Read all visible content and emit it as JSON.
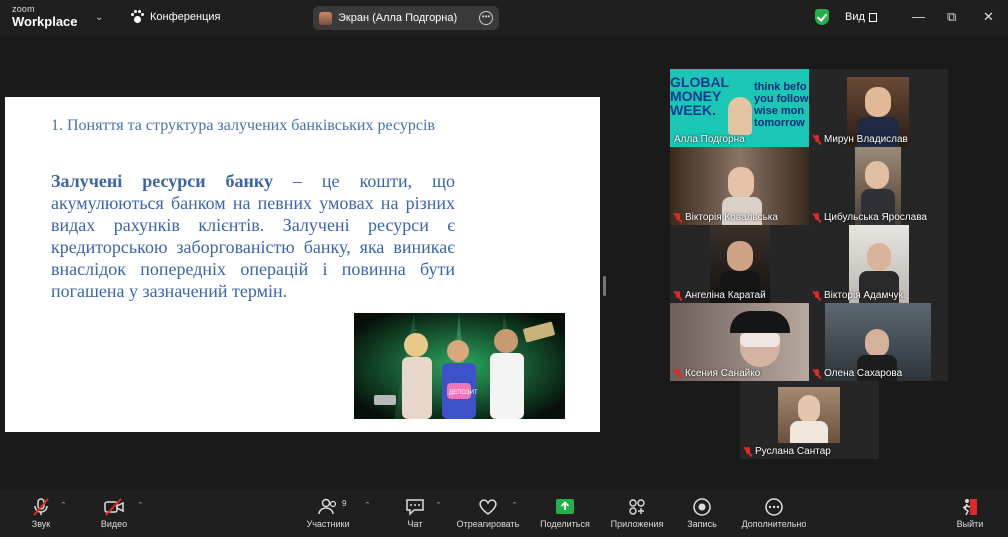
{
  "app": {
    "brand_top": "zoom",
    "brand_bottom": "Workplace"
  },
  "titlebar": {
    "meeting_label": "Конференция",
    "share_pill": "Экран (Алла Подгорна)",
    "view_label": "Вид",
    "shield_color": "#23b14d"
  },
  "slide": {
    "heading": "1. Поняття та структура залучених банківських ресурсів",
    "term": "Залучені ресурси банку",
    "body": " – це кошти, що акумулюються банком на певних умовах на різних видах рахунків клієнтів. Залучені ресурси є кредиторською заборгованістю банку, яка виникає внаслідок попередніх операцій і повинна бути погашена у зазначений термін.",
    "text_color": "#3d63ad",
    "photo_caption": "ДЕПОЗИТ"
  },
  "participants": [
    {
      "name": "Алла Подгорна",
      "muted": false,
      "active": true,
      "banner": [
        "think befo",
        "you follow",
        "wise mon",
        "tomorrow"
      ],
      "banner_left": [
        "GLOBAL",
        "MONEY",
        "WEEK."
      ]
    },
    {
      "name": "Мирун Владислав",
      "muted": true
    },
    {
      "name": "Вікторія Ковальська",
      "muted": true
    },
    {
      "name": "Цибульська Ярослава",
      "muted": true
    },
    {
      "name": "Ангеліна Каратай",
      "muted": true
    },
    {
      "name": "Вікторія Адамчук",
      "muted": true
    },
    {
      "name": "Ксения Санайко",
      "muted": true
    },
    {
      "name": "Олена Сахарова",
      "muted": true
    },
    {
      "name": "Руслана Сантар",
      "muted": true
    }
  ],
  "toolbar": {
    "audio": "Звук",
    "video": "Видео",
    "participants": "Участники",
    "participants_count": "9",
    "chat": "Чат",
    "react": "Отреагировать",
    "share": "Поделиться",
    "apps": "Приложения",
    "record": "Запись",
    "more": "Дополнительно",
    "leave": "Выйти",
    "share_color": "#22b14c",
    "leave_color": "#e02828"
  }
}
